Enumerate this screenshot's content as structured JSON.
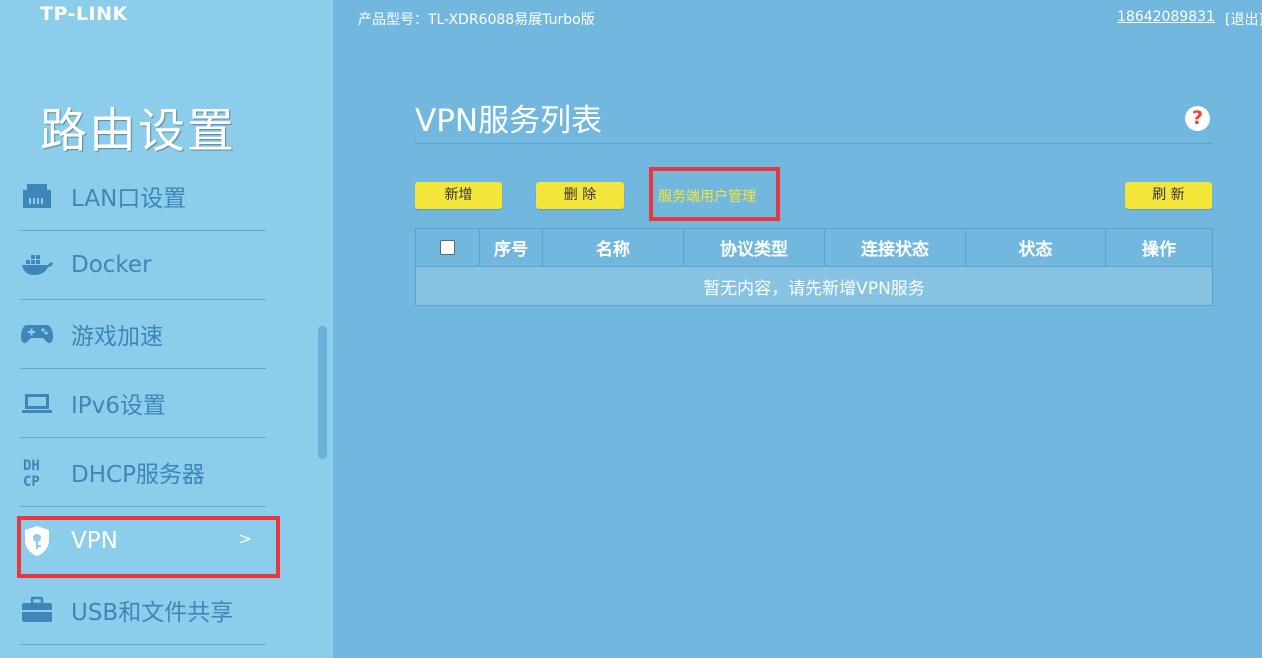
{
  "brand": {
    "logo": "TP-LINK"
  },
  "header": {
    "model": "产品型号：TL-XDR6088易展Turbo版",
    "account": "18642089831",
    "logout": "[退出]"
  },
  "sidebar": {
    "title": "路由设置",
    "items": [
      {
        "label": "LAN口设置",
        "icon": "ethernet-port-icon"
      },
      {
        "label": "Docker",
        "icon": "docker-whale-icon"
      },
      {
        "label": "游戏加速",
        "icon": "gamepad-icon"
      },
      {
        "label": "IPv6设置",
        "icon": "laptop-icon"
      },
      {
        "label": "DHCP服务器",
        "icon": "dhcp-text-icon"
      },
      {
        "label": "VPN",
        "icon": "shield-key-icon",
        "active": true,
        "arrow": ">"
      },
      {
        "label": "USB和文件共享",
        "icon": "briefcase-icon"
      }
    ]
  },
  "main": {
    "title": "VPN服务列表",
    "help": "?",
    "buttons": {
      "add": "新增",
      "delete": "删 除",
      "user_manage": "服务端用户管理",
      "refresh": "刷 新"
    },
    "table": {
      "columns": [
        "序号",
        "名称",
        "协议类型",
        "连接状态",
        "状态",
        "操作"
      ],
      "empty_message": "暂无内容，请先新增VPN服务"
    }
  },
  "colors": {
    "background": "#72b7dd",
    "sidebar": "#8ccdeb",
    "button": "#f4e53a",
    "highlight": "#e8383d",
    "help_icon": "#e8452c"
  }
}
